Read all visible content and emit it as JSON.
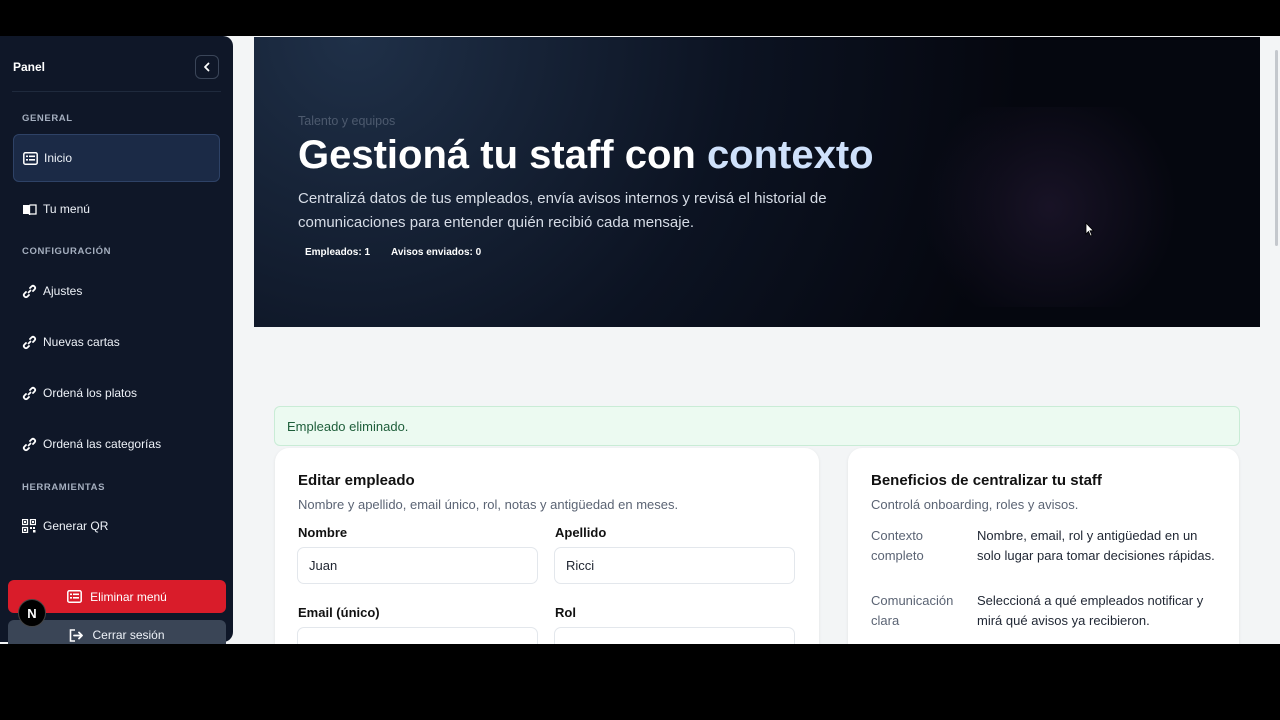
{
  "sidebar": {
    "title": "Panel",
    "sections": {
      "general": "GENERAL",
      "config": "CONFIGURACIÓN",
      "tools": "HERRAMIENTAS"
    },
    "items": {
      "inicio": "Inicio",
      "tu_menu": "Tu menú",
      "ajustes": "Ajustes",
      "nuevas_cartas": "Nuevas cartas",
      "ordena_platos": "Ordená los platos",
      "ordena_categorias": "Ordená las categorías",
      "generar_qr": "Generar QR"
    },
    "delete_label": "Eliminar menú",
    "logout_label": "Cerrar sesión",
    "badge": "N"
  },
  "hero": {
    "eyebrow": "Talento y equipos",
    "title_main": "Gestioná tu staff con ",
    "title_accent": "contexto",
    "description": "Centralizá datos de tus empleados, envía avisos internos y revisá el historial de comunicaciones para entender quién recibió cada mensaje.",
    "stats": {
      "employees": "Empleados: 1",
      "notices": "Avisos enviados: 0"
    }
  },
  "alert": "Empleado eliminado.",
  "edit_card": {
    "title": "Editar empleado",
    "subtitle": "Nombre y apellido, email único, rol, notas y antigüedad en meses.",
    "labels": {
      "nombre": "Nombre",
      "apellido": "Apellido",
      "email": "Email (único)",
      "rol": "Rol"
    },
    "values": {
      "nombre": "Juan",
      "apellido": "Ricci"
    }
  },
  "benefits_card": {
    "title": "Beneficios de centralizar tu staff",
    "subtitle": "Controlá onboarding, roles y avisos.",
    "rows": [
      {
        "key": "Contexto completo",
        "value": "Nombre, email, rol y antigüedad en un solo lugar para tomar decisiones rápidas."
      },
      {
        "key": "Comunicación clara",
        "value": "Seleccioná a qué empleados notificar y mirá qué avisos ya recibieron."
      }
    ]
  },
  "colors": {
    "sidebar_bg": "#0f1728",
    "danger": "#d91c2a",
    "accent_text": "#cfe1fb",
    "success_bg": "#ecfaf1"
  }
}
